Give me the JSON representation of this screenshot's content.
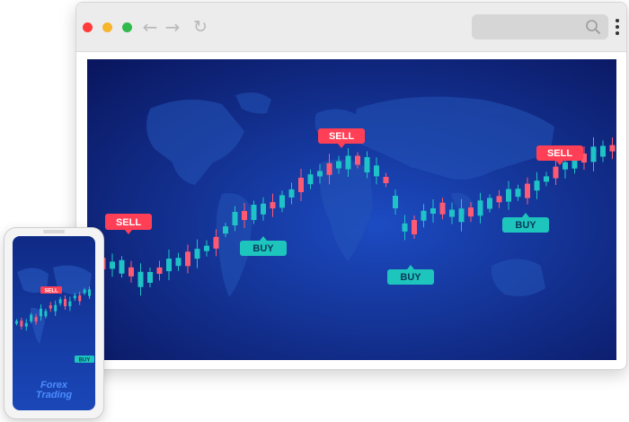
{
  "browser": {
    "controls": [
      "close",
      "minimize",
      "maximize"
    ],
    "nav_icons": [
      "back-arrow-icon",
      "forward-arrow-icon",
      "reload-icon"
    ],
    "search_icon": "search-icon",
    "menu_icon": "kebab-menu-icon"
  },
  "chart_labels": {
    "sell_left": "SELL",
    "sell_top": "SELL",
    "sell_right": "SELL",
    "buy_1": "BUY",
    "buy_2": "BUY",
    "buy_3": "BUY"
  },
  "phone": {
    "labels": {
      "sell": "SELL",
      "buy": "BUY"
    },
    "title_line1": "Forex",
    "title_line2": "Trading"
  },
  "colors": {
    "bullish": "#1fc3c7",
    "bearish": "#ff5a73",
    "sell_tag": "#ff3f55",
    "buy_tag": "#1ec5bd",
    "background_dark": "#0a1760",
    "background_light": "#1c4bc2"
  }
}
